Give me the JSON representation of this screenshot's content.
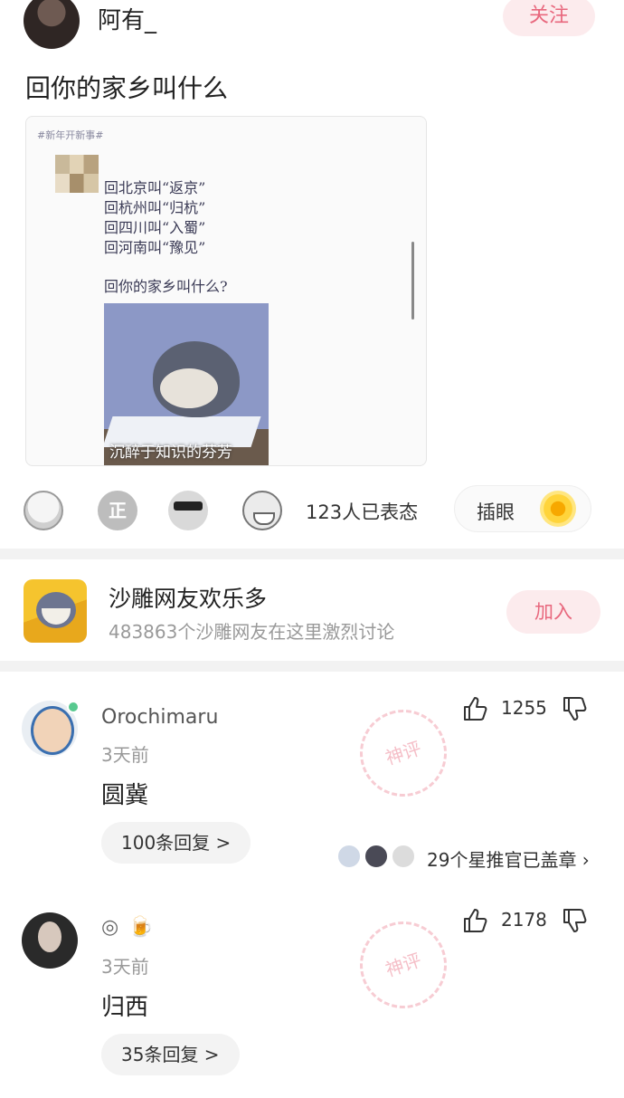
{
  "author": {
    "name": "阿有_",
    "follow_label": "关注"
  },
  "post": {
    "title": "回你的家乡叫什么",
    "image": {
      "tag": "#新年开新事#",
      "lines": [
        "回北京叫“返京”",
        "回杭州叫“归杭”",
        "回四川叫“入蜀”",
        "回河南叫“豫见”"
      ],
      "question": "回你的家乡叫什么?",
      "meme_caption": "沉醉于知识的芬芳"
    }
  },
  "reactions": {
    "icons": [
      "laugh-emoji-icon",
      "zheng-badge-icon",
      "sunglasses-emoji-icon",
      "grin-emoji-icon"
    ],
    "count_text": "123人已表态",
    "insert_label": "插眼",
    "insert_icon": "sunflower-icon"
  },
  "group": {
    "name": "沙雕网友欢乐多",
    "description": "483863个沙雕网友在这里激烈讨论",
    "join_label": "加入"
  },
  "comments": [
    {
      "user": "Orochimaru",
      "time": "3天前",
      "text": "圆冀",
      "likes": "1255",
      "reply_label": "100条回复 >",
      "stamp_text": "29个星推官已盖章 ›",
      "watermark": "神评",
      "online": true
    },
    {
      "user": "",
      "time": "3天前",
      "text": "归西",
      "likes": "2178",
      "reply_label": "35条回复 >",
      "watermark": "神评"
    }
  ],
  "colors": {
    "accent": "#e8677d",
    "accent_bg": "#fcebed",
    "muted": "#999999",
    "online": "#58c98f"
  }
}
